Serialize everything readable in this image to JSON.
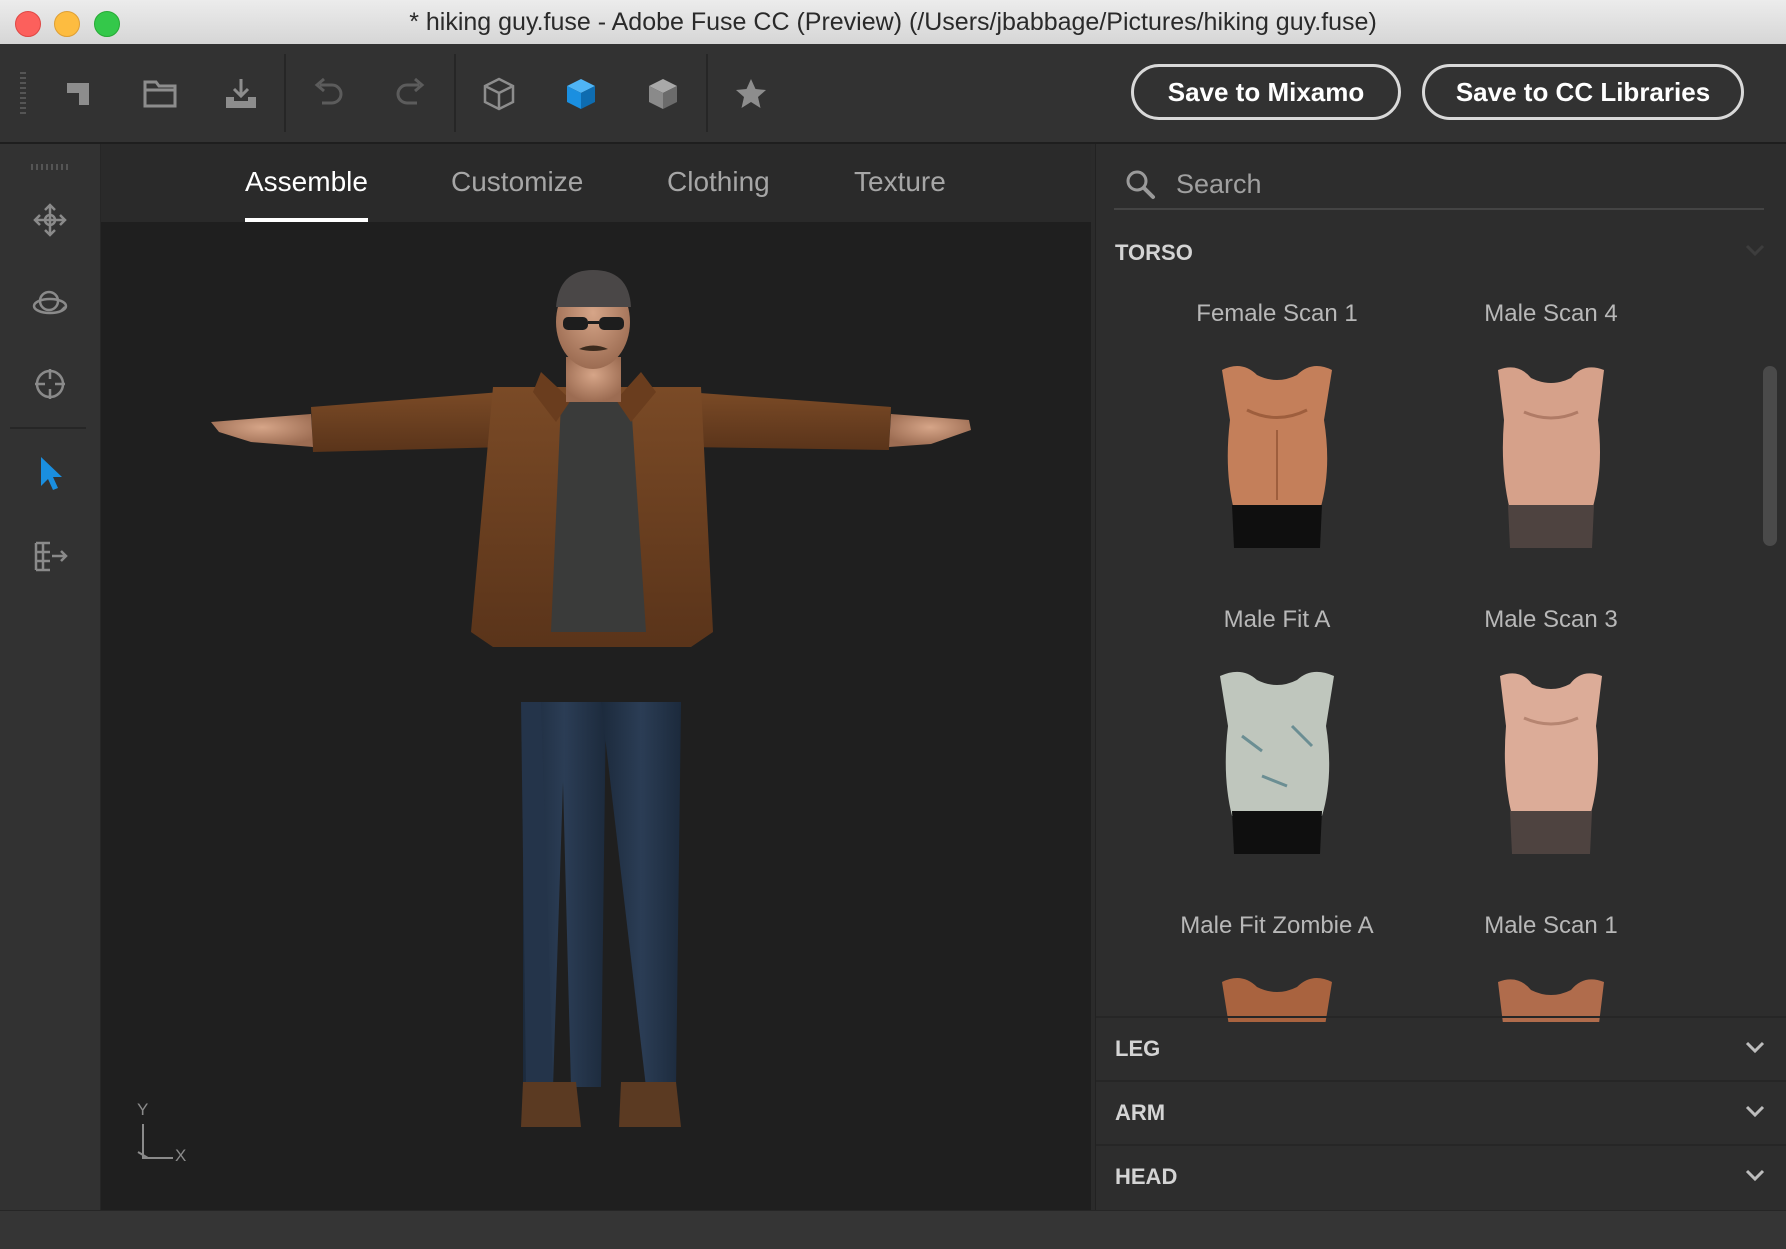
{
  "window": {
    "title": "* hiking guy.fuse - Adobe Fuse CC (Preview) (/Users/jbabbage/Pictures/hiking guy.fuse)"
  },
  "toolbar": {
    "icons": [
      "new-file-icon",
      "open-folder-icon",
      "import-icon",
      "undo-icon",
      "redo-icon",
      "wireframe-cube-icon",
      "shaded-cube-icon",
      "textured-cube-icon",
      "star-icon"
    ],
    "save_mixamo_label": "Save to Mixamo",
    "save_cc_label": "Save to CC Libraries",
    "accent_color": "#1a8fe0"
  },
  "left_tools": [
    "move-icon",
    "orbit-icon",
    "target-icon",
    "select-arrow-icon",
    "export-pose-icon"
  ],
  "tabs": [
    {
      "label": "Assemble",
      "active": true
    },
    {
      "label": "Customize",
      "active": false
    },
    {
      "label": "Clothing",
      "active": false
    },
    {
      "label": "Texture",
      "active": false
    }
  ],
  "viewport": {
    "axis_y": "Y",
    "axis_x": "X"
  },
  "panel": {
    "search_placeholder": "Search",
    "torso": {
      "title": "TORSO",
      "items": [
        {
          "label": "Female Scan 1"
        },
        {
          "label": "Male Scan 4"
        },
        {
          "label": "Male Fit A"
        },
        {
          "label": "Male Scan 3"
        },
        {
          "label": "Male Fit Zombie A"
        },
        {
          "label": "Male Scan 1"
        }
      ]
    },
    "sections": [
      {
        "title": "LEG"
      },
      {
        "title": "ARM"
      },
      {
        "title": "HEAD"
      }
    ]
  }
}
